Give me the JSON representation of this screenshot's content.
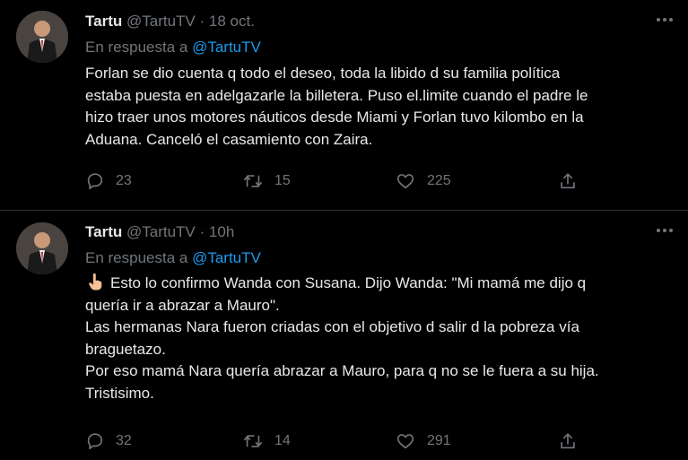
{
  "colors": {
    "background": "#000000",
    "text": "#e7e9ea",
    "muted": "#71767b",
    "link": "#1d9bf0",
    "divider": "#2f3336"
  },
  "tweets": [
    {
      "name": "Tartu",
      "handle": "@TartuTV",
      "separator": "·",
      "time": "18 oct.",
      "reply_prefix": "En respuesta a ",
      "reply_to": "@TartuTV",
      "lines": [
        "Forlan se dio cuenta q todo el deseo, toda la libido d su familia política",
        "estaba puesta en adelgazarle la billetera. Puso el.limite cuando el padre le",
        "hizo traer unos motores náuticos desde Miami y Forlan tuvo kilombo en la",
        "Aduana. Canceló el casamiento con Zaira."
      ],
      "replies": "23",
      "retweets": "15",
      "likes": "225",
      "icons": {
        "reply": "comment-icon",
        "retweet": "retweet-icon",
        "like": "heart-icon",
        "share": "share-icon",
        "more": "more-icon"
      }
    },
    {
      "name": "Tartu",
      "handle": "@TartuTV",
      "separator": "·",
      "time": "10h",
      "reply_prefix": "En respuesta a ",
      "reply_to": "@TartuTV",
      "emoji": "pointing-hand-emoji",
      "lines": [
        "Esto lo confirmo Wanda con Susana. Dijo Wanda: \"Mi mamá me dijo q",
        "quería ir a abrazar a Mauro\".",
        "Las hermanas Nara fueron criadas con el objetivo d salir d la pobreza vía",
        "braguetazo.",
        "Por eso mamá Nara quería abrazar a Mauro, para q no se le fuera a su hija.",
        "Tristisimo."
      ],
      "replies": "32",
      "retweets": "14",
      "likes": "291",
      "icons": {
        "reply": "comment-icon",
        "retweet": "retweet-icon",
        "like": "heart-icon",
        "share": "share-icon",
        "more": "more-icon"
      }
    }
  ]
}
